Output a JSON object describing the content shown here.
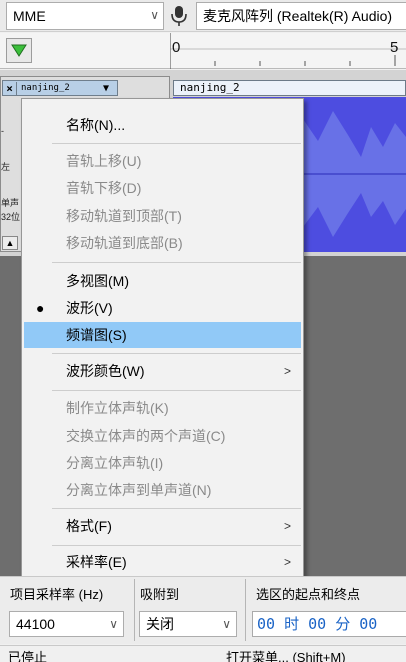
{
  "device_toolbar": {
    "host": "MME",
    "recording_device": "麦克风阵列 (Realtek(R) Audio)",
    "icons": [
      "chevron-down",
      "microphone"
    ]
  },
  "timeline": {
    "ruler_labels": [
      "0",
      "5"
    ]
  },
  "track": {
    "name": "nanjing_2",
    "clip_name": "nanjing_2",
    "side_labels": [
      "-",
      "左",
      "单声",
      "32位"
    ]
  },
  "context_menu": {
    "items": [
      {
        "label": "名称(N)...",
        "enabled": true
      },
      {
        "label": "音轨上移(U)",
        "enabled": false
      },
      {
        "label": "音轨下移(D)",
        "enabled": false
      },
      {
        "label": "移动轨道到顶部(T)",
        "enabled": false
      },
      {
        "label": "移动轨道到底部(B)",
        "enabled": false
      },
      {
        "label": "多视图(M)",
        "enabled": true
      },
      {
        "label": "波形(V)",
        "enabled": true,
        "checked": true
      },
      {
        "label": "频谱图(S)",
        "enabled": true,
        "highlighted": true
      },
      {
        "label": "波形颜色(W)",
        "enabled": true,
        "submenu": true
      },
      {
        "label": "制作立体声轨(K)",
        "enabled": false
      },
      {
        "label": "交换立体声的两个声道(C)",
        "enabled": false
      },
      {
        "label": "分离立体声轨(I)",
        "enabled": false
      },
      {
        "label": "分离立体声到单声道(N)",
        "enabled": false
      },
      {
        "label": "格式(F)",
        "enabled": true,
        "submenu": true
      },
      {
        "label": "采样率(E)",
        "enabled": true,
        "submenu": true
      }
    ]
  },
  "selection_toolbar": {
    "project_rate_label": "项目采样率 (Hz)",
    "snap_label": "吸附到",
    "selection_label": "选区的起点和终点",
    "project_rate_value": "44100",
    "snap_value": "关闭",
    "time_value": "00 时 00 分 00"
  },
  "status_bar": {
    "state": "已停止",
    "hint": "打开菜单... (Shift+M)"
  },
  "colors": {
    "waveform": "#4d4de0",
    "menu_highlight": "#91c9f7",
    "track_background": "#6e6e6e",
    "time_digits": "#1a63c6"
  }
}
